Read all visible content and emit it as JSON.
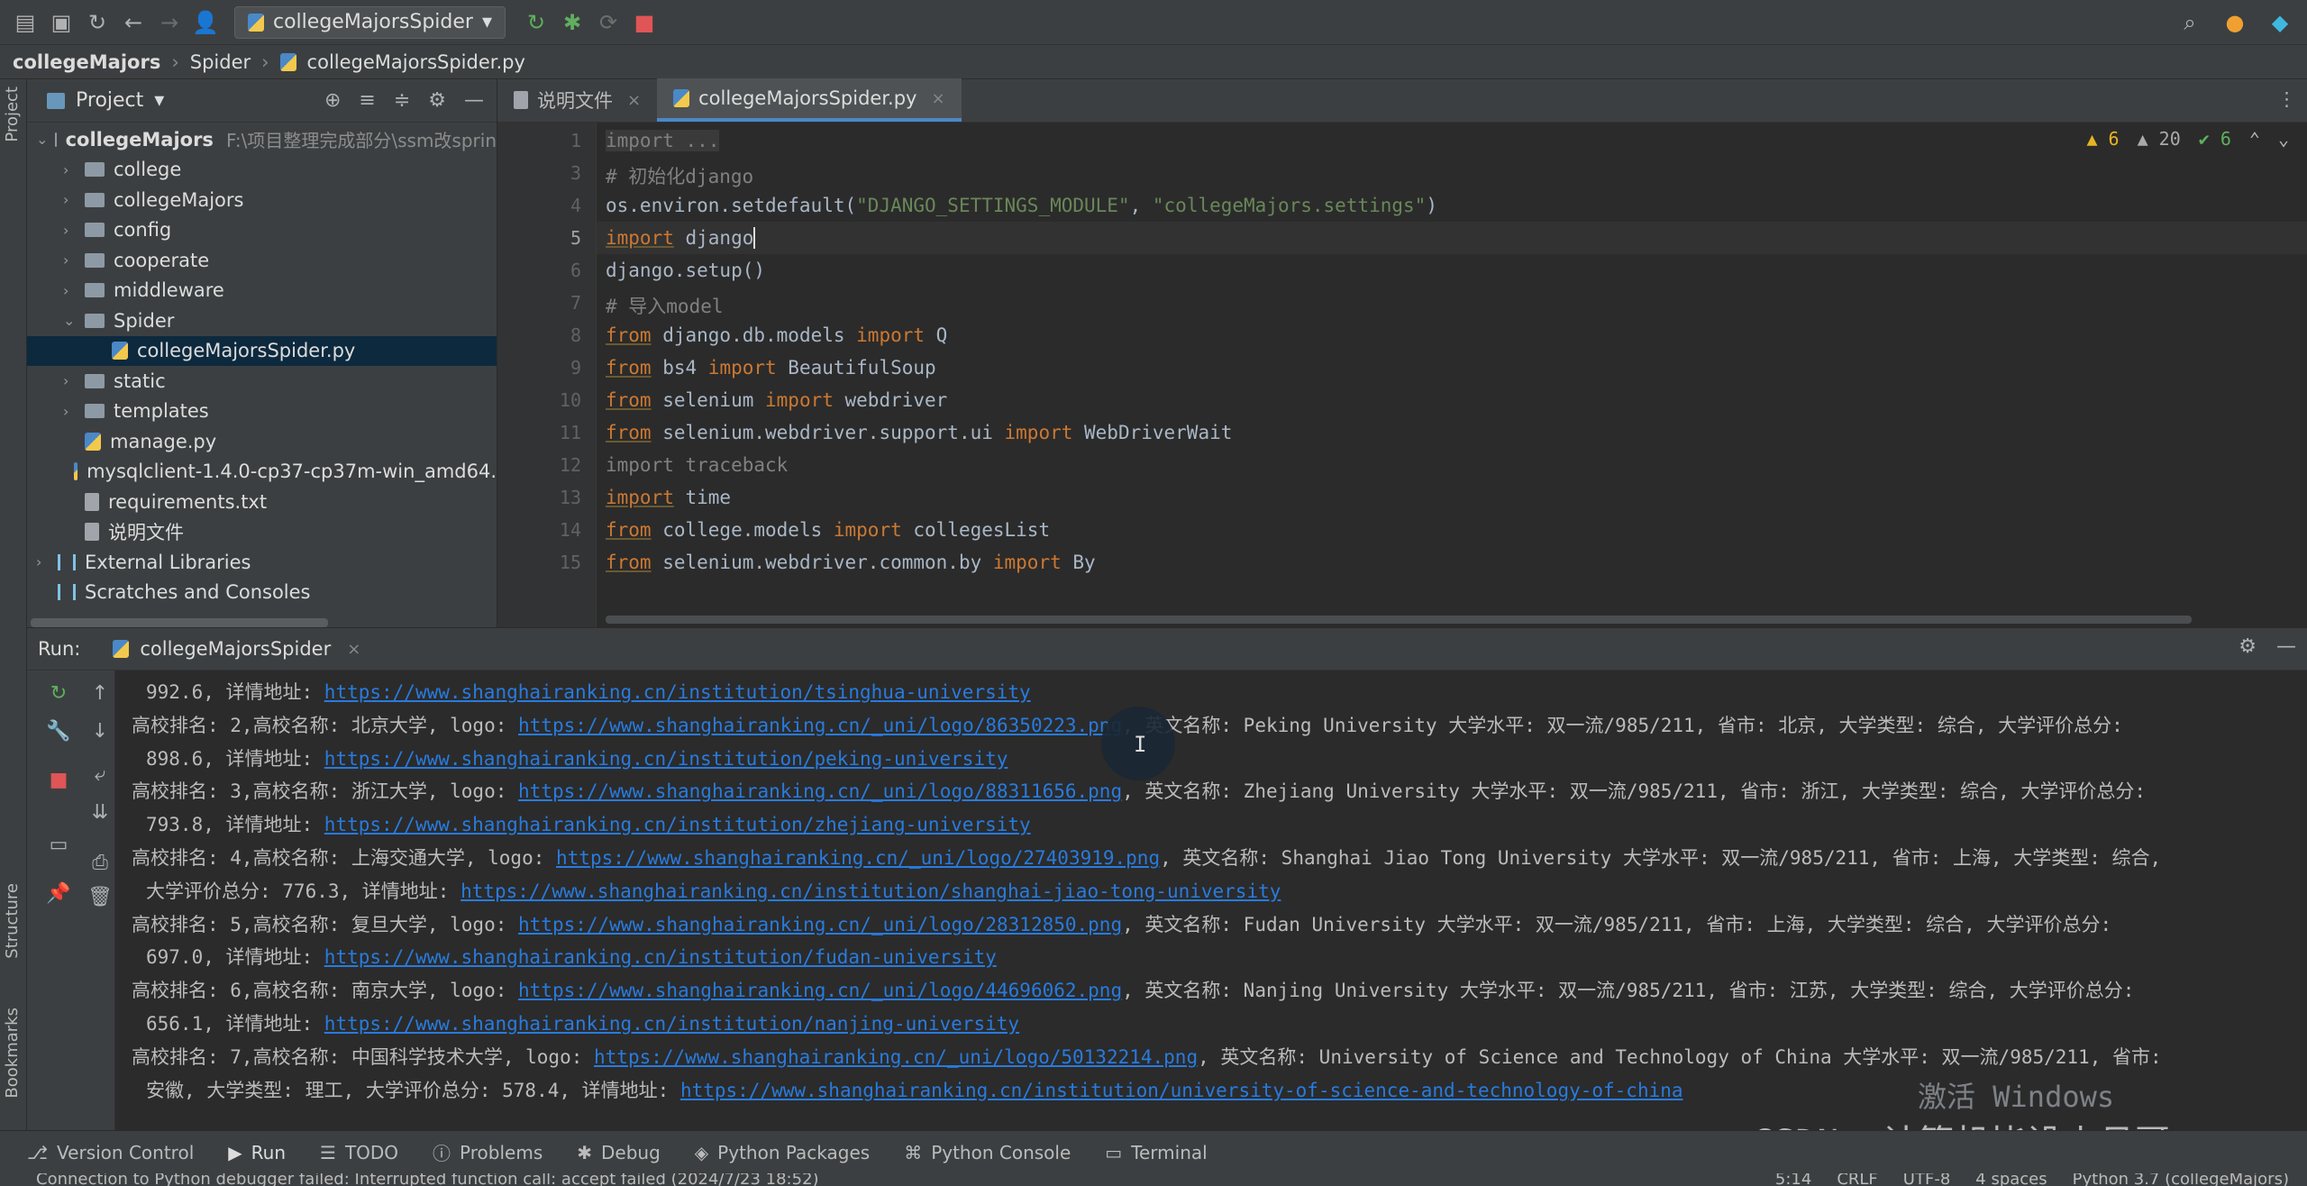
{
  "toolbar": {
    "run_config": "collegeMajorsSpider"
  },
  "breadcrumb": [
    "collegeMajors",
    "Spider",
    "collegeMajorsSpider.py"
  ],
  "left_stripe": {
    "project_label": "Project",
    "structure_label": "Structure",
    "bookmarks_label": "Bookmarks"
  },
  "project": {
    "title": "Project",
    "tree": [
      {
        "label": "collegeMajors",
        "hint": "F:\\项目整理完成部分\\ssm改sprin",
        "type": "folder",
        "indent": 0,
        "open": true
      },
      {
        "label": "college",
        "type": "folder",
        "indent": 1
      },
      {
        "label": "collegeMajors",
        "type": "folder",
        "indent": 1
      },
      {
        "label": "config",
        "type": "folder",
        "indent": 1
      },
      {
        "label": "cooperate",
        "type": "folder",
        "indent": 1
      },
      {
        "label": "middleware",
        "type": "folder",
        "indent": 1
      },
      {
        "label": "Spider",
        "type": "folder",
        "indent": 1,
        "open": true
      },
      {
        "label": "collegeMajorsSpider.py",
        "type": "py",
        "indent": 2,
        "selected": true
      },
      {
        "label": "static",
        "type": "folder",
        "indent": 1
      },
      {
        "label": "templates",
        "type": "folder",
        "indent": 1
      },
      {
        "label": "manage.py",
        "type": "py",
        "indent": 1
      },
      {
        "label": "mysqlclient-1.4.0-cp37-cp37m-win_amd64.",
        "type": "py",
        "indent": 1
      },
      {
        "label": "requirements.txt",
        "type": "txt",
        "indent": 1
      },
      {
        "label": "说明文件",
        "type": "txt",
        "indent": 1
      },
      {
        "label": "External Libraries",
        "type": "lib",
        "indent": 0
      },
      {
        "label": "Scratches and Consoles",
        "type": "lib",
        "indent": 0
      }
    ]
  },
  "editor": {
    "tabs": [
      {
        "label": "说明文件",
        "active": false
      },
      {
        "label": "collegeMajorsSpider.py",
        "active": true
      }
    ],
    "inspections": {
      "warnings": "6",
      "weak_warnings": "20",
      "ok": "6"
    },
    "line_numbers": [
      "1",
      "3",
      "4",
      "5",
      "6",
      "7",
      "8",
      "9",
      "10",
      "11",
      "12",
      "13",
      "14",
      "15"
    ],
    "code": {
      "l1": "import ...",
      "l3": "# 初始化django",
      "l4a": "os.environ.setdefault(",
      "l4b": "\"DJANGO_SETTINGS_MODULE\"",
      "l4c": ", ",
      "l4d": "\"collegeMajors.settings\"",
      "l4e": ")",
      "import_kw": "import",
      "from_kw": "from",
      "l5b": " django",
      "l6": "django.setup()",
      "l7": "# 导入model",
      "l8a": " django.db.models ",
      "l8b": " Q",
      "l9a": " bs4 ",
      "l9b": " BeautifulSoup",
      "l10a": " selenium ",
      "l10b": " webdriver",
      "l11a": " selenium.webdriver.support.ui ",
      "l11b": " WebDriverWait",
      "l12": "import traceback",
      "l13b": " time",
      "l14a": " college.models ",
      "l14b": " collegesList",
      "l15a": " selenium.webdriver.common.by ",
      "l15b": " By"
    }
  },
  "run": {
    "label": "Run:",
    "tab": "collegeMajorsSpider",
    "console": [
      {
        "t1": "992.6, 详情地址: ",
        "u1": "https://www.shanghairanking.cn/institution/tsinghua-university",
        "indent": true
      },
      {
        "t1": "高校排名: 2,高校名称: 北京大学, logo: ",
        "u1": "https://www.shanghairanking.cn/_uni/logo/86350223.png",
        "t2": ", 英文名称: Peking University 大学水平: 双一流/985/211, 省市: 北京, 大学类型: 综合, 大学评价总分:"
      },
      {
        "t1": "898.6, 详情地址: ",
        "u1": "https://www.shanghairanking.cn/institution/peking-university",
        "indent": true
      },
      {
        "t1": "高校排名: 3,高校名称: 浙江大学, logo: ",
        "u1": "https://www.shanghairanking.cn/_uni/logo/88311656.png",
        "t2": ", 英文名称: Zhejiang University 大学水平: 双一流/985/211, 省市: 浙江, 大学类型: 综合, 大学评价总分:"
      },
      {
        "t1": "793.8, 详情地址: ",
        "u1": "https://www.shanghairanking.cn/institution/zhejiang-university",
        "indent": true
      },
      {
        "t1": "高校排名: 4,高校名称: 上海交通大学, logo: ",
        "u1": "https://www.shanghairanking.cn/_uni/logo/27403919.png",
        "t2": ", 英文名称: Shanghai Jiao Tong University 大学水平: 双一流/985/211, 省市: 上海, 大学类型: 综合,"
      },
      {
        "t1": "大学评价总分: 776.3, 详情地址: ",
        "u1": "https://www.shanghairanking.cn/institution/shanghai-jiao-tong-university",
        "indent": true
      },
      {
        "t1": "高校排名: 5,高校名称: 复旦大学, logo: ",
        "u1": "https://www.shanghairanking.cn/_uni/logo/28312850.png",
        "t2": ", 英文名称: Fudan University 大学水平: 双一流/985/211, 省市: 上海, 大学类型: 综合, 大学评价总分:"
      },
      {
        "t1": "697.0, 详情地址: ",
        "u1": "https://www.shanghairanking.cn/institution/fudan-university",
        "indent": true
      },
      {
        "t1": "高校排名: 6,高校名称: 南京大学, logo: ",
        "u1": "https://www.shanghairanking.cn/_uni/logo/44696062.png",
        "t2": ", 英文名称: Nanjing University 大学水平: 双一流/985/211, 省市: 江苏, 大学类型: 综合, 大学评价总分:"
      },
      {
        "t1": "656.1, 详情地址: ",
        "u1": "https://www.shanghairanking.cn/institution/nanjing-university",
        "indent": true
      },
      {
        "t1": "高校排名: 7,高校名称: 中国科学技术大学, logo: ",
        "u1": "https://www.shanghairanking.cn/_uni/logo/50132214.png",
        "t2": ", 英文名称: University of Science and Technology of China 大学水平: 双一流/985/211, 省市:"
      },
      {
        "t1": "安徽, 大学类型: 理工, 大学评价总分: 578.4, 详情地址: ",
        "u1": "https://www.shanghairanking.cn/institution/university-of-science-and-technology-of-china",
        "indent": true
      }
    ]
  },
  "bottom_tabs": [
    "Version Control",
    "Run",
    "TODO",
    "Problems",
    "Debug",
    "Python Packages",
    "Python Console",
    "Terminal"
  ],
  "status": {
    "message": "Connection to Python debugger failed: Interrupted function call: accept failed (2024/7/23 18:52)",
    "position": "5:14",
    "line_sep": "CRLF",
    "encoding": "UTF-8",
    "indent": "4 spaces",
    "interpreter": "Python 3.7 (collegeMajors)"
  },
  "watermarks": {
    "activate": "激活 Windows",
    "csdn": "CSDN @计算机毕设小月哥"
  }
}
